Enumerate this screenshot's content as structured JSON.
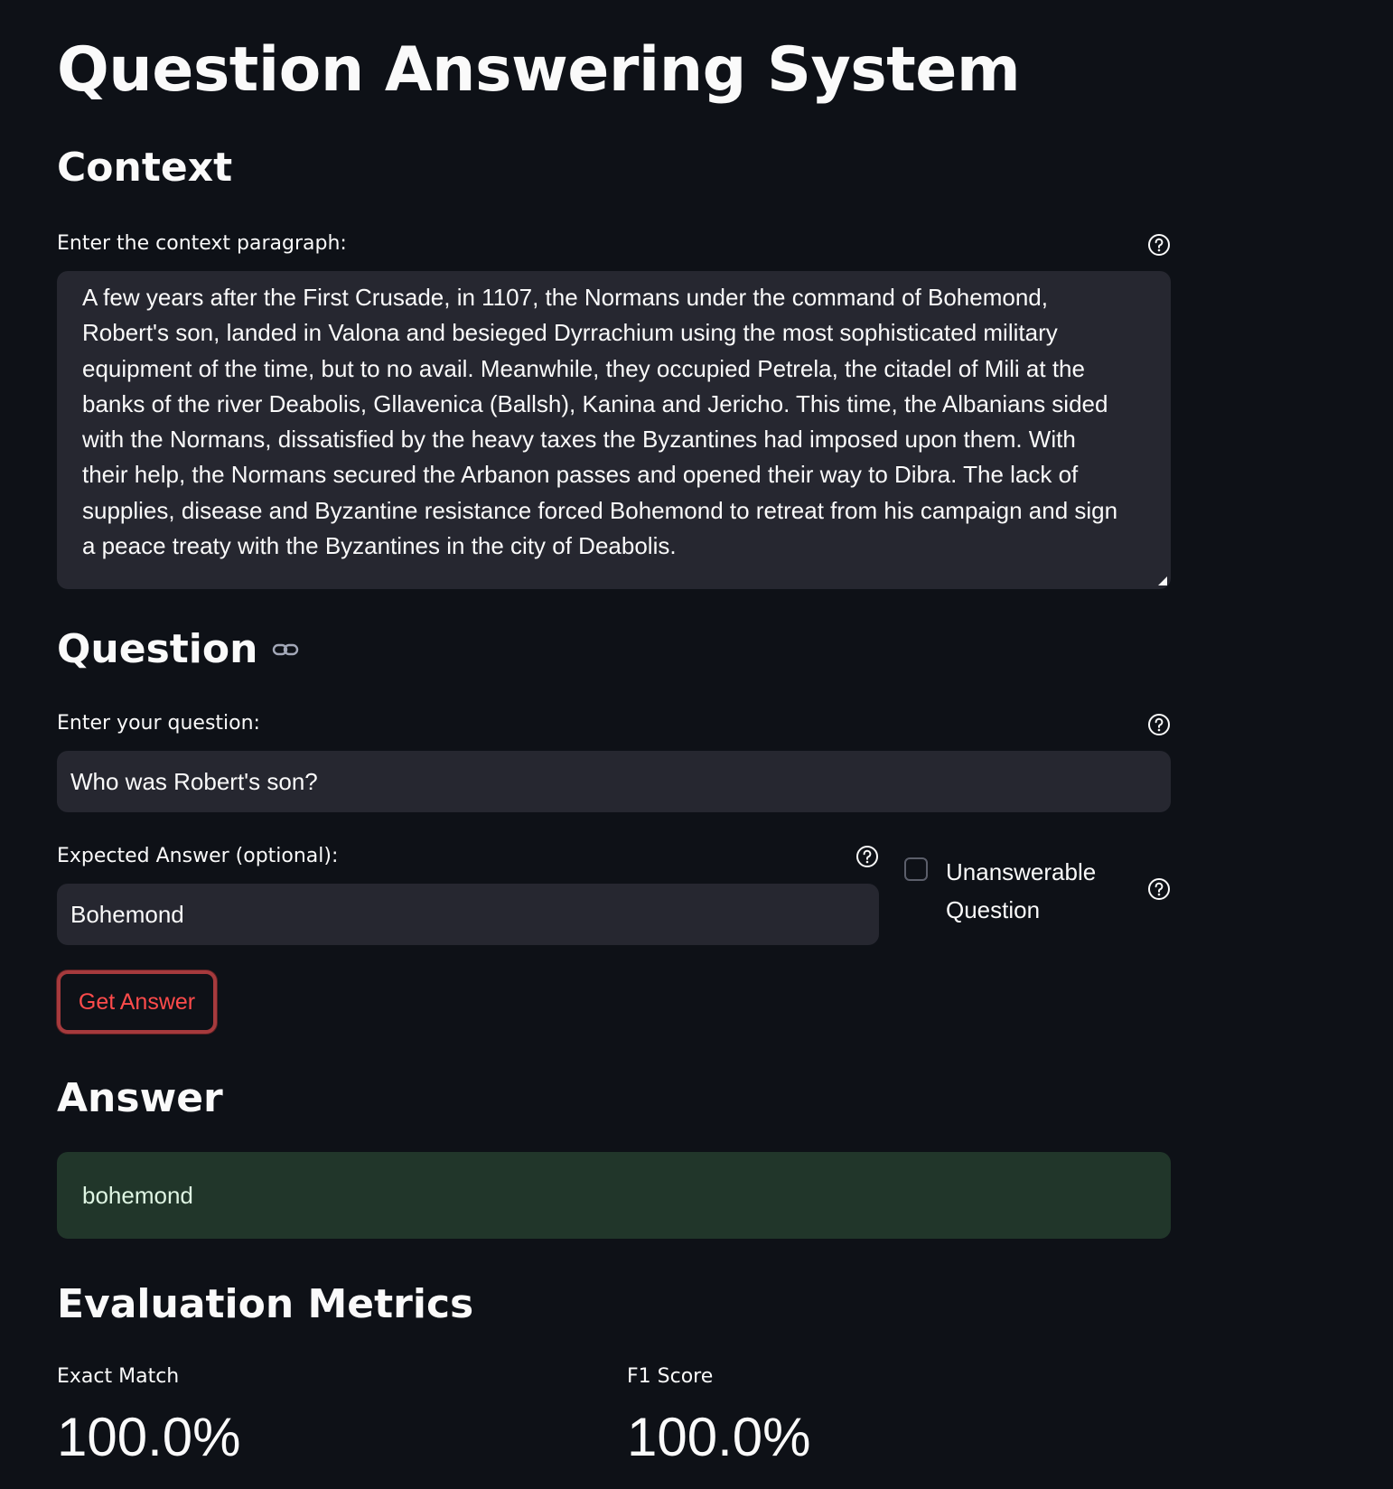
{
  "app": {
    "title": "Question Answering System"
  },
  "context_section": {
    "heading": "Context",
    "field_label": "Enter the context paragraph:",
    "paragraph_lines": [
      "A few years after the First Crusade, in 1107, the Normans under the command of Bohemond,",
      "Robert's son, landed in Valona and besieged Dyrrachium using the most sophisticated military",
      "equipment of the time, but to no avail. Meanwhile, they occupied Petrela, the citadel of Mili at the",
      "banks of the river Deabolis, Gllavenica (Ballsh), Kanina and Jericho. This time, the Albanians sided",
      "with the Normans, dissatisfied by the heavy taxes the Byzantines had imposed upon them. With",
      "their help, the Normans secured the Arbanon passes and opened their way to Dibra. The lack of",
      "supplies, disease and Byzantine resistance forced Bohemond to retreat from his campaign and sign",
      "a peace treaty with the Byzantines in the city of Deabolis."
    ],
    "help_icon": "question-circle-icon"
  },
  "question_section": {
    "heading": "Question",
    "heading_icon": "link-icon",
    "field_label": "Enter your question:",
    "value": "Who was Robert's son?",
    "help_icon": "question-circle-icon"
  },
  "expected_answer": {
    "field_label": "Expected Answer (optional):",
    "value": "Bohemond",
    "help_icon": "question-circle-icon"
  },
  "unanswerable": {
    "label_line1": "Unanswerable",
    "label_line2": "Question",
    "checked": false,
    "help_icon": "question-circle-icon"
  },
  "get_answer_button": {
    "label": "Get Answer"
  },
  "answer_section": {
    "heading": "Answer",
    "value": "bohemond"
  },
  "metrics_section": {
    "heading": "Evaluation Metrics",
    "metrics": [
      {
        "label": "Exact Match",
        "value": "100.0%"
      },
      {
        "label": "F1 Score",
        "value": "100.0%"
      }
    ]
  },
  "colors": {
    "background": "#0e1117",
    "input_background": "#262730",
    "accent_red": "#ff4b4b",
    "success_background": "#21362a"
  }
}
